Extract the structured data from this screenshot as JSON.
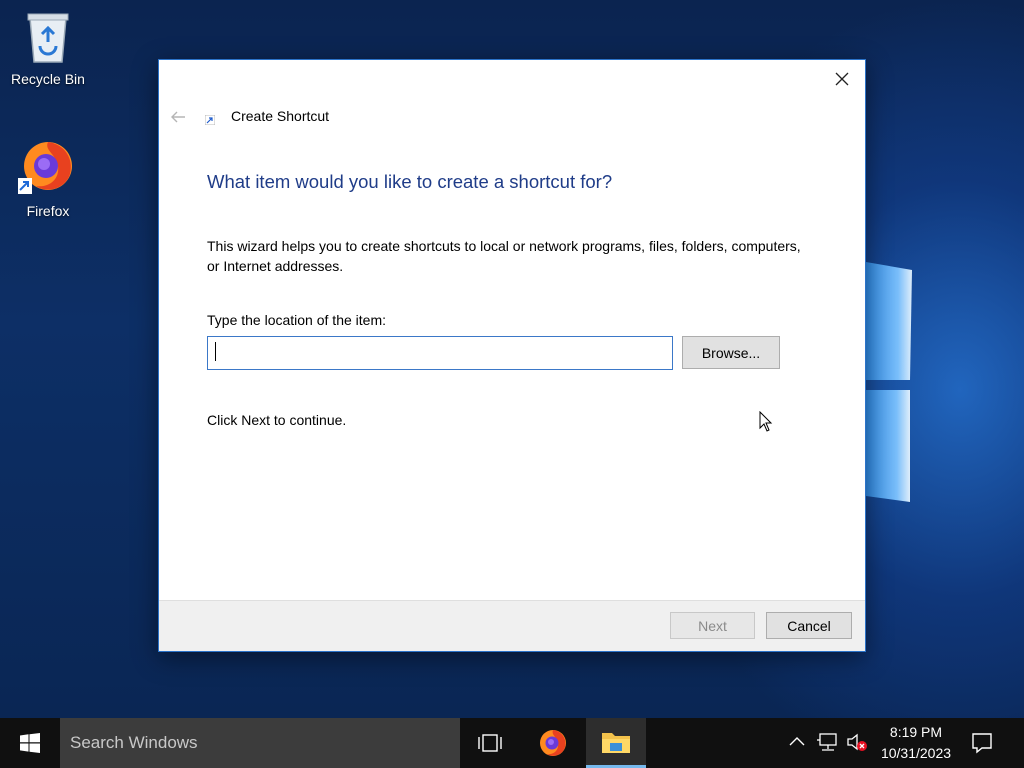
{
  "desktop": {
    "icons": [
      {
        "label": "Recycle Bin"
      },
      {
        "label": "Firefox"
      }
    ]
  },
  "dialog": {
    "title": "Create Shortcut",
    "heading": "What item would you like to create a shortcut for?",
    "description": "This wizard helps you to create shortcuts to local or network programs, files, folders, computers, or Internet addresses.",
    "location_label": "Type the location of the item:",
    "location_value": "",
    "browse_label": "Browse...",
    "hint": "Click Next to continue.",
    "next_label": "Next",
    "cancel_label": "Cancel"
  },
  "taskbar": {
    "search_placeholder": "Search Windows",
    "clock_time": "8:19 PM",
    "clock_date": "10/31/2023"
  },
  "colors": {
    "heading": "#1f3c88",
    "dialog_border": "#2b73c9",
    "taskbar": "#101010",
    "active_indicator": "#76b9ed"
  }
}
